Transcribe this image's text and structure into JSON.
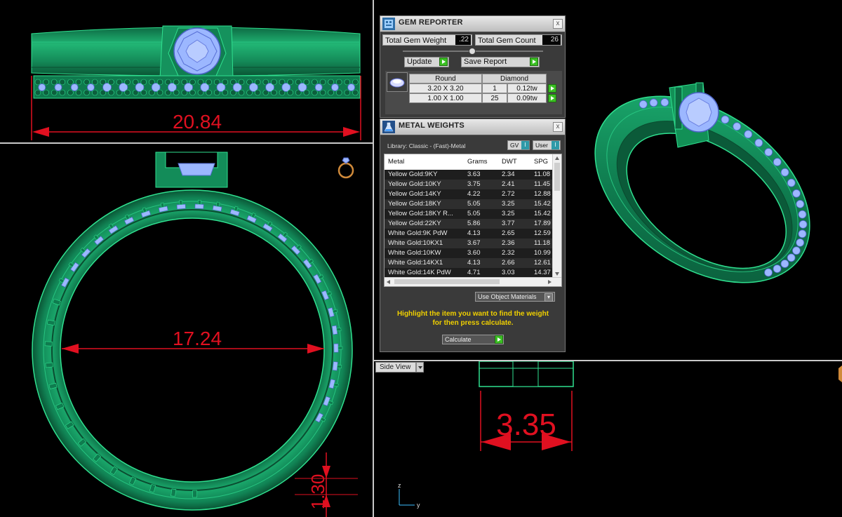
{
  "viewports": {
    "top_dimension": "20.84",
    "front_inner_dimension": "17.24",
    "front_band_dimension": "1.30",
    "side_dimension": "3.35",
    "side_view_label": "Side View",
    "axis_z": "z",
    "axis_y": "y"
  },
  "gem_reporter": {
    "title": "GEM REPORTER",
    "close": "x",
    "total_weight_label": "Total Gem Weight",
    "total_weight_value": ".22",
    "total_count_label": "Total Gem Count",
    "total_count_value": "26",
    "update_label": "Update",
    "save_report_label": "Save Report",
    "table_header_shape": "Round",
    "table_header_type": "Diamond",
    "rows": [
      {
        "size": "3.20 X 3.20",
        "count": "1",
        "weight": "0.12tw"
      },
      {
        "size": "1.00 X 1.00",
        "count": "25",
        "weight": "0.09tw"
      }
    ]
  },
  "metal_weights": {
    "title": "METAL WEIGHTS",
    "close": "x",
    "library_label": "Library: Classic - (Fast)-Metal",
    "gv_label": "GV",
    "gv_value": "I",
    "user_label": "User",
    "user_value": "I",
    "columns": [
      "Metal",
      "Grams",
      "DWT",
      "SPG"
    ],
    "rows": [
      {
        "metal": "Yellow Gold:9KY",
        "grams": "3.63",
        "dwt": "2.34",
        "spg": "11.08"
      },
      {
        "metal": "Yellow Gold:10KY",
        "grams": "3.75",
        "dwt": "2.41",
        "spg": "11.45"
      },
      {
        "metal": "Yellow Gold:14KY",
        "grams": "4.22",
        "dwt": "2.72",
        "spg": "12.88"
      },
      {
        "metal": "Yellow Gold:18KY",
        "grams": "5.05",
        "dwt": "3.25",
        "spg": "15.42"
      },
      {
        "metal": "Yellow Gold:18KY R...",
        "grams": "5.05",
        "dwt": "3.25",
        "spg": "15.42"
      },
      {
        "metal": "Yellow Gold:22KY",
        "grams": "5.86",
        "dwt": "3.77",
        "spg": "17.89"
      },
      {
        "metal": "White Gold:9K PdW",
        "grams": "4.13",
        "dwt": "2.65",
        "spg": "12.59"
      },
      {
        "metal": "White Gold:10KX1",
        "grams": "3.67",
        "dwt": "2.36",
        "spg": "11.18"
      },
      {
        "metal": "White Gold:10KW",
        "grams": "3.60",
        "dwt": "2.32",
        "spg": "10.99"
      },
      {
        "metal": "White Gold:14KX1",
        "grams": "4.13",
        "dwt": "2.66",
        "spg": "12.61"
      },
      {
        "metal": "White Gold:14K PdW",
        "grams": "4.71",
        "dwt": "3.03",
        "spg": "14.37"
      }
    ],
    "materials_dropdown": "Use Object Materials",
    "hint_line1": "Highlight the item you want to find the weight",
    "hint_line2": "for then press calculate.",
    "calculate_label": "Calculate"
  },
  "colors": {
    "metal_green": "#169a63",
    "gem_blue": "#9cb7ff",
    "dimension_red": "#e01020",
    "hint_yellow": "#f0d000",
    "go_green": "#3bbf23"
  }
}
